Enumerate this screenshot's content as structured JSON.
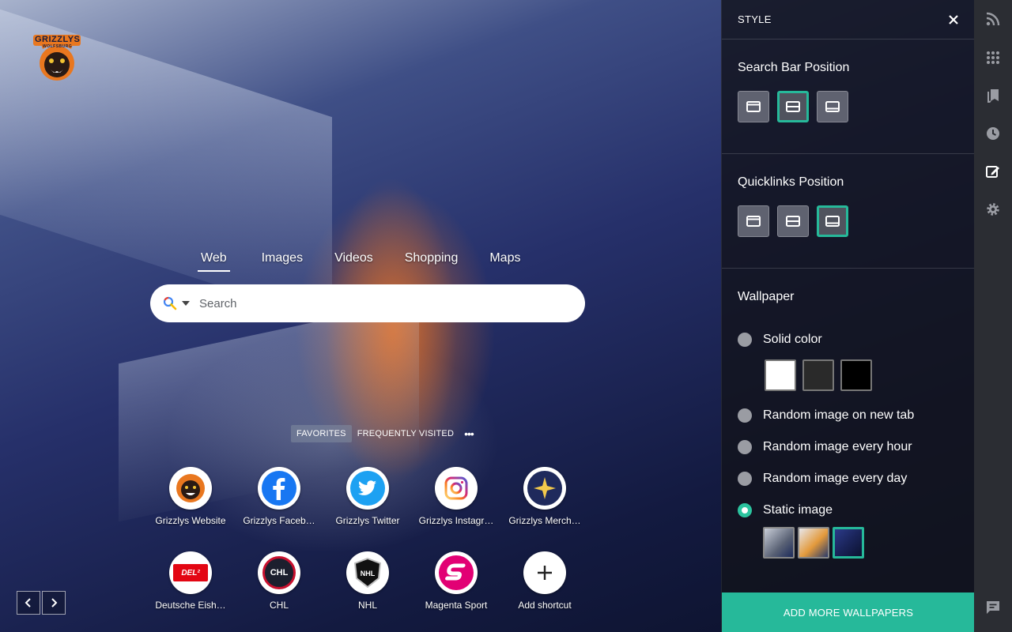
{
  "logo": {
    "text": "GRIZZLYS",
    "subtext": "WOLFSBURG"
  },
  "search": {
    "tabs": [
      {
        "label": "Web",
        "active": true
      },
      {
        "label": "Images",
        "active": false
      },
      {
        "label": "Videos",
        "active": false
      },
      {
        "label": "Shopping",
        "active": false
      },
      {
        "label": "Maps",
        "active": false
      }
    ],
    "placeholder": "Search",
    "engine_icon": "search-icon"
  },
  "quicklinks": {
    "tabs": [
      {
        "label": "FAVORITES",
        "active": true
      },
      {
        "label": "FREQUENTLY VISITED",
        "active": false
      }
    ],
    "more": "•••",
    "items": [
      {
        "label": "Grizzlys Website",
        "icon": "grizzlys-bear-icon"
      },
      {
        "label": "Grizzlys Faceb…",
        "icon": "facebook-icon"
      },
      {
        "label": "Grizzlys Twitter",
        "icon": "twitter-icon"
      },
      {
        "label": "Grizzlys Instagr…",
        "icon": "instagram-icon"
      },
      {
        "label": "Grizzlys Merch…",
        "icon": "merch-star-icon"
      },
      {
        "label": "Deutsche Eish…",
        "icon": "del-logo-icon"
      },
      {
        "label": "CHL",
        "icon": "chl-logo-icon"
      },
      {
        "label": "NHL",
        "icon": "nhl-logo-icon"
      },
      {
        "label": "Magenta Sport",
        "icon": "magenta-sport-icon"
      },
      {
        "label": "Add shortcut",
        "icon": "plus-icon"
      }
    ],
    "del_badge": "DEL²",
    "chl_badge": "CHL",
    "nhl_badge": "NHL"
  },
  "panel": {
    "title": "STYLE",
    "search_bar_position": {
      "label": "Search Bar Position",
      "options": [
        "top",
        "middle",
        "bottom"
      ],
      "selected": "middle"
    },
    "quicklinks_position": {
      "label": "Quicklinks Position",
      "options": [
        "top",
        "middle",
        "bottom"
      ],
      "selected": "bottom"
    },
    "wallpaper": {
      "label": "Wallpaper",
      "options": [
        {
          "label": "Solid color",
          "checked": false
        },
        {
          "label": "Random image on new tab",
          "checked": false
        },
        {
          "label": "Random image every hour",
          "checked": false
        },
        {
          "label": "Random image every day",
          "checked": false
        },
        {
          "label": "Static image",
          "checked": true
        }
      ],
      "solid_colors": [
        "#ffffff",
        "#2a2a2a",
        "#000000"
      ]
    },
    "add_button": "ADD MORE WALLPAPERS"
  },
  "colors": {
    "accent": "#26b99a",
    "panel_bg": "#14161c",
    "rail_bg": "#2b2d33"
  },
  "rail_icons": [
    "rss-icon",
    "apps-grid-icon",
    "bookmarks-icon",
    "history-icon",
    "style-edit-icon",
    "settings-gear-icon",
    "feedback-icon"
  ]
}
